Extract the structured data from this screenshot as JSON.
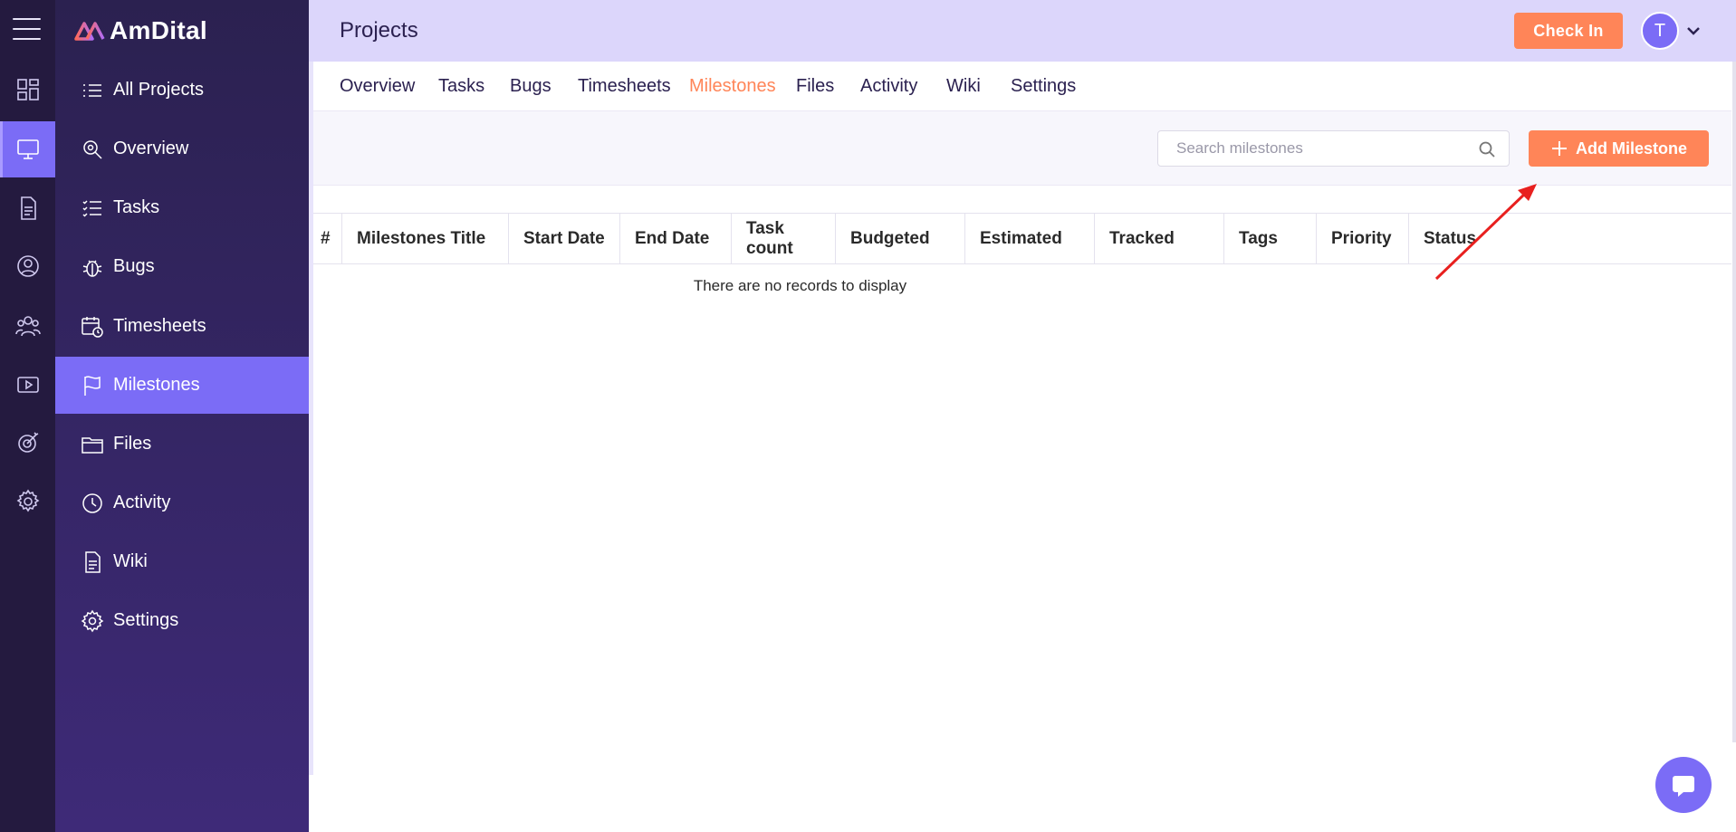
{
  "brand": {
    "name": "AmDital",
    "logo_icon": "amdital-logo-icon"
  },
  "rail": {
    "menu_icon": "hamburger-icon",
    "items": [
      {
        "icon": "dashboard-icon",
        "active": false
      },
      {
        "icon": "monitor-icon",
        "active": true
      },
      {
        "icon": "document-icon",
        "active": false
      },
      {
        "icon": "user-circle-icon",
        "active": false
      },
      {
        "icon": "team-icon",
        "active": false
      },
      {
        "icon": "video-icon",
        "active": false
      },
      {
        "icon": "target-icon",
        "active": false
      },
      {
        "icon": "gear-icon",
        "active": false
      }
    ]
  },
  "sidebar": {
    "items": [
      {
        "label": "All Projects",
        "icon": "list-icon"
      },
      {
        "label": "Overview",
        "icon": "eye-search-icon"
      },
      {
        "label": "Tasks",
        "icon": "checklist-icon"
      },
      {
        "label": "Bugs",
        "icon": "bug-icon"
      },
      {
        "label": "Timesheets",
        "icon": "calendar-clock-icon"
      },
      {
        "label": "Milestones",
        "icon": "flag-icon",
        "active": true
      },
      {
        "label": "Files",
        "icon": "folder-icon"
      },
      {
        "label": "Activity",
        "icon": "clock-icon"
      },
      {
        "label": "Wiki",
        "icon": "file-text-icon"
      },
      {
        "label": "Settings",
        "icon": "gear-icon"
      }
    ]
  },
  "header": {
    "title": "Projects",
    "checkin_label": "Check In",
    "avatar_initial": "T"
  },
  "tabs": [
    {
      "label": "Overview"
    },
    {
      "label": "Tasks"
    },
    {
      "label": "Bugs"
    },
    {
      "label": "Timesheets"
    },
    {
      "label": "Milestones",
      "active": true
    },
    {
      "label": "Files"
    },
    {
      "label": "Activity"
    },
    {
      "label": "Wiki"
    },
    {
      "label": "Settings"
    }
  ],
  "toolbar": {
    "search_placeholder": "Search milestones",
    "add_label": "Add Milestone"
  },
  "table": {
    "columns": [
      "#",
      "Milestones Title",
      "Start Date",
      "End Date",
      "Task count",
      "Budgeted",
      "Estimated",
      "Tracked",
      "Tags",
      "Priority",
      "Status"
    ],
    "empty_message": "There are no records to display"
  },
  "colors": {
    "accent": "#ff8558",
    "primary": "#7b6cf6",
    "sidebar_dark": "#241a3f",
    "header_bg": "#dcd6fb",
    "annotation_arrow": "#e8201f"
  }
}
